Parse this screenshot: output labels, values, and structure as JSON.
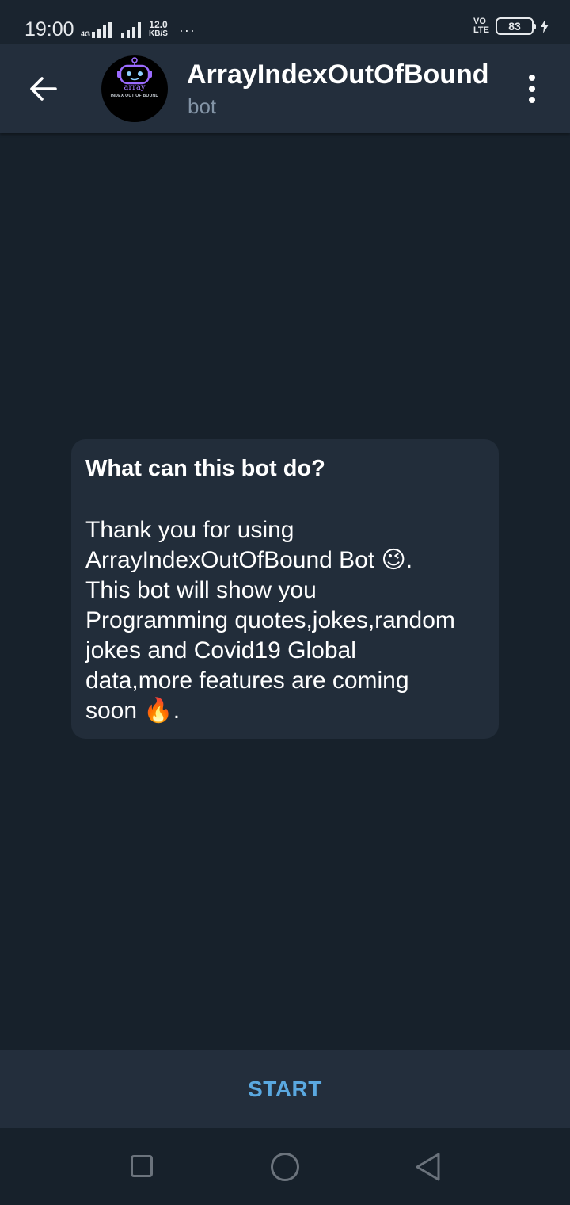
{
  "status_bar": {
    "time": "19:00",
    "network_type": "4G",
    "speed_value": "12.0",
    "speed_unit": "KB/S",
    "more": "···",
    "volte_top": "VO",
    "volte_bottom": "LTE",
    "battery": "83"
  },
  "header": {
    "back_icon": "arrow-left-icon",
    "title": "ArrayIndexOutOfBound",
    "subtitle": "bot",
    "avatar": {
      "word": "array",
      "caption": "INDEX OUT OF BOUND"
    },
    "menu_icon": "more-vertical-icon"
  },
  "bot_info": {
    "title": "What can this bot do?",
    "body": "Thank you for using\nArrayIndexOutOfBound Bot 😉.\nThis bot will show you\nProgramming quotes,jokes,random\njokes and Covid19 Global\ndata,more features are coming\nsoon 🔥."
  },
  "start": {
    "label": "START"
  },
  "nav": {
    "recents_icon": "square-icon",
    "home_icon": "circle-icon",
    "back_icon": "triangle-back-icon"
  },
  "colors": {
    "background": "#17212b",
    "header": "#232e3c",
    "card": "#222d3a",
    "accent": "#5aa8e0",
    "subtitle": "#8394a6"
  }
}
